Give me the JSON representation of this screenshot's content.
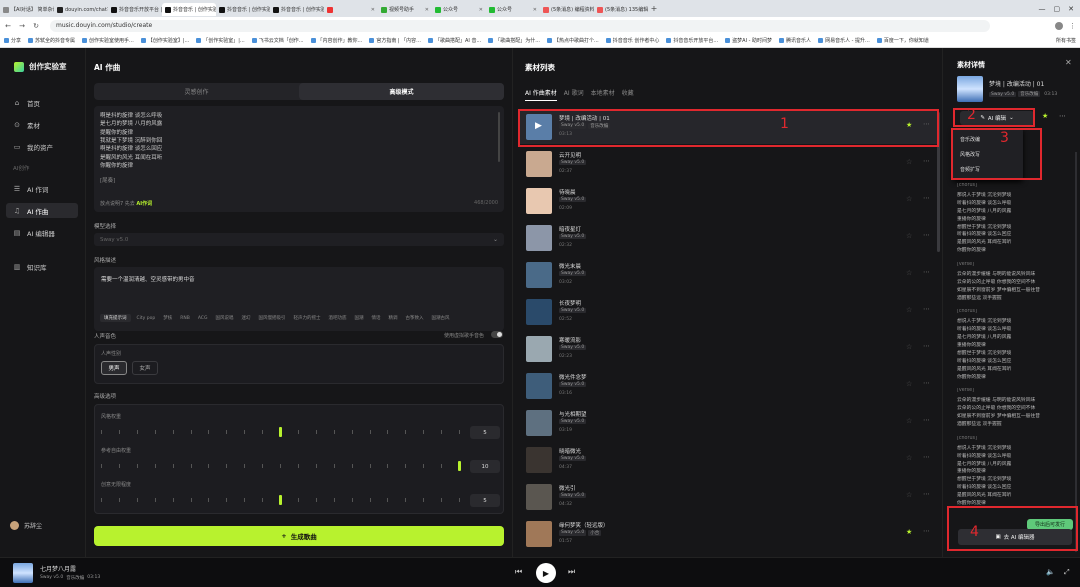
{
  "browser": {
    "tabs": [
      {
        "label": "【AI对话】 简单杂谈",
        "color": "#888"
      },
      {
        "label": "douyin.com/chat?isP",
        "color": "#222"
      },
      {
        "label": "抖音音乐开放平台 | 看",
        "color": "#111"
      },
      {
        "label": "抖音音乐 | 创作实验室",
        "color": "#111",
        "active": true
      },
      {
        "label": "抖音音乐 | 创作实验",
        "color": "#111"
      },
      {
        "label": "抖音音乐 | 创作实验",
        "color": "#111"
      },
      {
        "label": "",
        "color": "#e33"
      },
      {
        "label": "视频号助手",
        "color": "#3a3"
      },
      {
        "label": "公众号",
        "color": "#2b3"
      },
      {
        "label": "公众号",
        "color": "#2b3"
      },
      {
        "label": "(5条消息) 编程资料-135",
        "color": "#e55"
      },
      {
        "label": "(5条消息) 135编辑器",
        "color": "#e55"
      }
    ],
    "url": "music.douyin.com/studio/create",
    "bookmarks": [
      "分享",
      "苏轼全的抖音专属",
      "创作实验室使用手...",
      "【创作实验室】|...",
      "「创作实验室」|...",
      "飞书云文档「创作...",
      "「内容创作」教你...",
      "官方指南 | 「内容...",
      "「歌曲搭配」AI 音...",
      "「歌曲搭配」为什...",
      "【热点中歌曲打个...",
      "抖音音乐 创作者中心",
      "抖音音乐开放平台...",
      "盗梦AI - 助时间梦",
      "腾讯音乐人",
      "网易音乐人 - 提升...",
      "百度一下，你就知道"
    ],
    "bookmarks_end": "所有书签"
  },
  "sidebar": {
    "logo": "创作实验室",
    "items": [
      {
        "label": "首页",
        "icon": "home-icon",
        "glyph": "⌂"
      },
      {
        "label": "素材",
        "icon": "material-icon",
        "glyph": "⊙"
      },
      {
        "label": "我的资产",
        "icon": "folder-icon",
        "glyph": "▭"
      }
    ],
    "section": "AI创作",
    "ai_items": [
      {
        "label": "AI 作词",
        "icon": "lyric-icon",
        "glyph": "☰"
      },
      {
        "label": "AI 作曲",
        "icon": "music-note-icon",
        "glyph": "♫",
        "active": true
      },
      {
        "label": "AI 编辑器",
        "icon": "editor-icon",
        "glyph": "▤"
      }
    ],
    "kb": {
      "label": "知识库",
      "icon": "book-icon",
      "glyph": "▥"
    },
    "user": "苏辞尘"
  },
  "compose": {
    "title": "AI 作曲",
    "tabs": [
      "灵感创作",
      "高级模式"
    ],
    "lyrics": [
      "啊是抖的旋律 谈怎么呼吸",
      "是七月的梦境 八月的风露",
      "提醒你的旋律",
      "我就是下梦境 沉醉到你回",
      "啊是抖的旋律 谈怎么回应",
      "是醒风的风光 耳闻在耳听",
      "你醒你的旋律"
    ],
    "lyrics_tag": "[尾奏]",
    "hint_prefix": "放点说明7 先去",
    "hint_link": "AI作词",
    "count": "468/2000",
    "model_label": "模型选择",
    "model_value": "Sway v5.0",
    "style_label": "风格描述",
    "style_desc": "需要一个温润清越、空灵感带的男中音",
    "chips": [
      "填充提示词",
      "City pop",
      "梦核",
      "RNB",
      "ACG",
      "国风说唱",
      "迷幻",
      "国风慢摇吸引",
      "轻声力的摇士",
      "酒吧功底",
      "国潮",
      "情话",
      "精调",
      "古筝致入",
      "国潮古风"
    ],
    "voice_label": "人声音色",
    "voice_toggle_label": "使用虚拟歌手音色",
    "voice_gender_label": "人声性别",
    "voices": [
      "男声",
      "女声"
    ],
    "adv_label": "高级选项",
    "sliders": [
      {
        "label": "风格权重",
        "value": "5",
        "pos": 0.5
      },
      {
        "label": "参考自由权重",
        "value": "10",
        "pos": 1.0
      },
      {
        "label": "创意无限程度",
        "value": "5",
        "pos": 0.5
      }
    ],
    "generate": "生成歌曲"
  },
  "materials": {
    "title": "素材列表",
    "tabs": [
      "AI 作曲素材",
      "AI 歌词",
      "本地素材",
      "收藏"
    ],
    "items": [
      {
        "name": "梦境 | 改编活动 | 01",
        "tags": [
          "Sway v5.0",
          "音乐改编"
        ],
        "dur": "03:13",
        "starred": true,
        "thumb": "#5a7ea8"
      },
      {
        "name": "云开见明",
        "tags": [
          "Sway v5.0"
        ],
        "dur": "02:37",
        "starred": false,
        "thumb": "#c9a990"
      },
      {
        "name": "待晓晨",
        "tags": [
          "Sway v5.0"
        ],
        "dur": "02:09",
        "starred": false,
        "thumb": "#e8c8b0"
      },
      {
        "name": "暗夜星灯",
        "tags": [
          "Sway v5.0"
        ],
        "dur": "02:32",
        "starred": false,
        "thumb": "#8c96a8"
      },
      {
        "name": "微光末晨",
        "tags": [
          "Sway v5.0"
        ],
        "dur": "03:02",
        "starred": false,
        "thumb": "#4a6a88"
      },
      {
        "name": "长夜梦明",
        "tags": [
          "Sway v5.0"
        ],
        "dur": "02:52",
        "starred": false,
        "thumb": "#2a4a6a"
      },
      {
        "name": "寒暖流影",
        "tags": [
          "Sway v5.0"
        ],
        "dur": "02:23",
        "starred": false,
        "thumb": "#9aa8b0"
      },
      {
        "name": "微光件念梦",
        "tags": [
          "Sway v5.0"
        ],
        "dur": "03:16",
        "starred": false,
        "thumb": "#3e5d7a"
      },
      {
        "name": "与光相期望",
        "tags": [
          "Sway v5.0"
        ],
        "dur": "03:19",
        "starred": false,
        "thumb": "#5e7080"
      },
      {
        "name": "晓暗微光",
        "tags": [
          "Sway v5.0"
        ],
        "dur": "04:37",
        "starred": false,
        "thumb": "#3a3430"
      },
      {
        "name": "微光引",
        "tags": [
          "Sway v5.0"
        ],
        "dur": "04:32",
        "starred": false,
        "thumb": "#5a5650"
      },
      {
        "name": "缘何梦笑（轻远版）",
        "tags": [
          "Sway v5.0",
          "小合"
        ],
        "dur": "01:57",
        "starred": true,
        "thumb": "#a07858"
      }
    ]
  },
  "detail": {
    "title": "素材详情",
    "name": "梦境 | 改编活动 | 01",
    "tags": [
      "Sway v5.0",
      "音乐改编"
    ],
    "dur": "03:13",
    "ai_edit": "AI 编辑",
    "menu": [
      "音乐改编",
      "风格改写",
      "音频扩写"
    ],
    "lyrics": [
      {
        "t": "[chorus]",
        "sec": true
      },
      {
        "t": "那说人于梦境 沉沦到梦境",
        "sec": false
      },
      {
        "t": "听着抖的旋律 谈怎么呼吸",
        "sec": false
      },
      {
        "t": "是七月的梦境 八月的风露",
        "sec": false
      },
      {
        "t": "重播你的旋律",
        "sec": false
      },
      {
        "t": "想醒世于梦境 沉沦到梦境",
        "sec": false
      },
      {
        "t": "听着抖的旋律 谈怎么回应",
        "sec": false
      },
      {
        "t": "是醒风的风光 耳闻在耳听",
        "sec": false
      },
      {
        "t": "你醒你的旋律",
        "sec": false
      },
      {
        "t": "",
        "sec": false
      },
      {
        "t": "[verse]",
        "sec": true
      },
      {
        "t": "云朵的漫步缓缓 与明的能说风铃风味",
        "sec": false
      },
      {
        "t": "云朵的公的止呼吸 你想我的空间不休",
        "sec": false
      },
      {
        "t": "如星辰不到窗前岁 梦中偏相互一般往昔",
        "sec": false
      },
      {
        "t": "酒醒那些远 双手握握",
        "sec": false
      },
      {
        "t": "",
        "sec": false
      },
      {
        "t": "[chorus]",
        "sec": true
      },
      {
        "t": "想说人于梦境 沉沦到梦境",
        "sec": false
      },
      {
        "t": "听着抖的旋律 谈怎么呼吸",
        "sec": false
      },
      {
        "t": "是七月的梦境 八月的风露",
        "sec": false
      },
      {
        "t": "重播你的旋律",
        "sec": false
      },
      {
        "t": "想醒世于梦境 沉沦到梦境",
        "sec": false
      },
      {
        "t": "听着抖的旋律 谈怎么回应",
        "sec": false
      },
      {
        "t": "是醒风的风光 耳闻在耳听",
        "sec": false
      },
      {
        "t": "你醒你的旋律",
        "sec": false
      },
      {
        "t": "",
        "sec": false
      },
      {
        "t": "[verse]",
        "sec": true
      },
      {
        "t": "云朵的漫步缓缓 与明的能说风铃风味",
        "sec": false
      },
      {
        "t": "云朵的公的止呼吸 你想我的空间不休",
        "sec": false
      },
      {
        "t": "如星辰不到窗前岁 梦中偏相互一般往昔",
        "sec": false
      },
      {
        "t": "酒醒那些远 双手握握",
        "sec": false
      },
      {
        "t": "",
        "sec": false
      },
      {
        "t": "[chorus]",
        "sec": true
      },
      {
        "t": "想说人于梦境 沉沦到梦境",
        "sec": false
      },
      {
        "t": "听着抖的旋律 谈怎么呼吸",
        "sec": false
      },
      {
        "t": "是七月的梦境 八月的风露",
        "sec": false
      },
      {
        "t": "重播你的旋律",
        "sec": false
      },
      {
        "t": "想醒世于梦境 沉沦到梦境",
        "sec": false
      },
      {
        "t": "听着抖的旋律 谈怎么回应",
        "sec": false
      },
      {
        "t": "是醒风的风光 耳闻在耳听",
        "sec": false
      },
      {
        "t": "你醒你的旋律",
        "sec": false
      }
    ],
    "export_tip": "导出后可发行",
    "go_edit": "去 AI 编辑器"
  },
  "annotations": [
    "1",
    "2",
    "3",
    "4"
  ],
  "player": {
    "name": "七月梦八月露",
    "tags": [
      "Sway v5.0",
      "音乐改编",
      "03:13"
    ]
  },
  "colors": {
    "accent": "#b8f22e",
    "annotation": "#e0282e",
    "bg": "#161618"
  }
}
